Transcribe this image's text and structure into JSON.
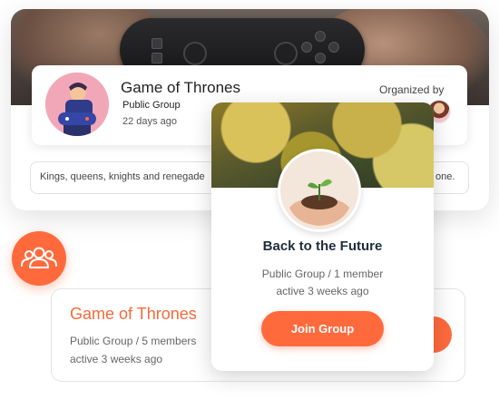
{
  "featured_group": {
    "title": "Game of Thrones",
    "type_label": "Public Group",
    "age": "22 days ago",
    "organized_label": "Organized by",
    "description_left": "Kings, queens, knights and renegade",
    "description_right": "one."
  },
  "group_icon": {
    "icon": "people-group-icon",
    "color": "#ff6a3d"
  },
  "list_group": {
    "title": "Game of Thrones",
    "meta_line1": "Public Group / 5 members",
    "meta_line2": "active 3 weeks ago"
  },
  "popup_group": {
    "title": "Back to the Future",
    "meta_line1": "Public Group / 1 member",
    "meta_line2": "active 3 weeks ago",
    "join_label": "Join Group"
  },
  "colors": {
    "accent": "#ff6a3d",
    "title_dark": "#1f2d3a",
    "title_orange": "#f26b3a"
  }
}
